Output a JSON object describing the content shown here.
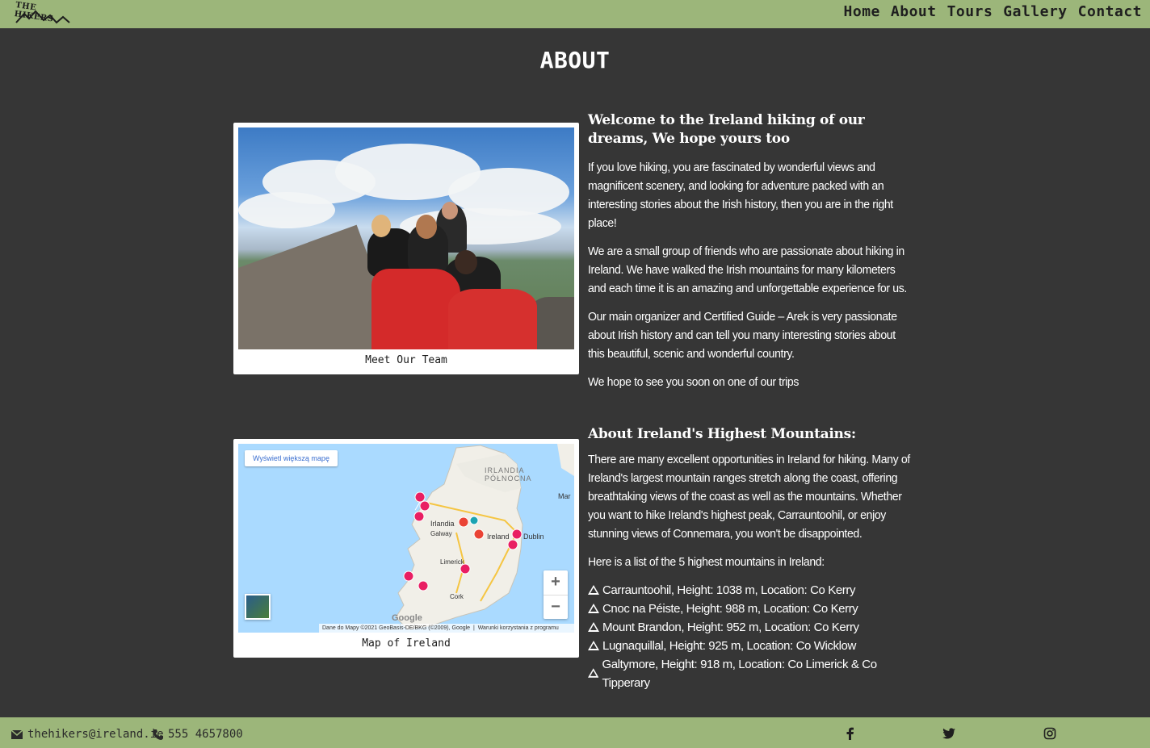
{
  "header": {
    "logo_text": "THE HIKERS",
    "nav": [
      "Home",
      "About",
      "Tours",
      "Gallery",
      "Contact"
    ]
  },
  "page_title": "ABOUT",
  "team_figure": {
    "caption": "Meet Our Team"
  },
  "map_figure": {
    "caption": "Map of Ireland",
    "view_larger_btn": "Wyświetl większą mapę",
    "labels": {
      "northern_ireland": "IRLANDIA\nPÓŁNOCNA",
      "irlandia": "Irlandia",
      "galway": "Galway",
      "ireland": "Ireland",
      "dublin": "Dublin",
      "limerick": "Limerick",
      "cork": "Cork",
      "mar": "Mar"
    },
    "attribution": "Dane do Mapy ©2021 GeoBasis-DE/BKG (©2009), Google",
    "terms": "Warunki korzystania z programu",
    "google": "Google",
    "zoom_in": "+",
    "zoom_out": "−"
  },
  "intro": {
    "heading": "Welcome to the Ireland hiking of our dreams, We hope yours too",
    "paragraphs": [
      "If you love hiking, you are fascinated by wonderful views and magnificent scenery, and looking for adventure packed with an interesting stories about the Irish history, then you are in the right place!",
      "We are a small group of friends who are passionate about hiking in Ireland. We have walked the Irish mountains for many kilometers and each time it is an amazing and unforgettable experience for us.",
      "Our main organizer and Certified Guide – Arek is very passionate about Irish history and can tell you many interesting stories about this beautiful, scenic and wonderful country.",
      "We hope to see you soon on one of our trips"
    ]
  },
  "mountains_section": {
    "heading": "About Ireland's Highest Mountains:",
    "paragraph": "There are many excellent opportunities in Ireland for hiking. Many of Ireland's largest mountain ranges stretch along the coast, offering breathtaking views of the coast as well as the mountains. Whether you want to hike Ireland's highest peak, Carrauntoohil, or enjoy stunning views of Connemara, you won't be disappointed.",
    "list_intro": "Here is a list of the 5 highest mountains in Ireland:",
    "mountains": [
      "Carrauntoohil, Height: 1038 m, Location: Co Kerry",
      "Cnoc na Péiste, Height: 988 m, Location: Co Kerry",
      "Mount Brandon, Height: 952 m, Location: Co Kerry",
      "Lugnaquillal, Height: 925 m, Location: Co Wicklow",
      "Galtymore, Height: 918 m, Location: Co Limerick & Co Tipperary"
    ]
  },
  "footer": {
    "email": "thehikers@ireland.ie",
    "phone": "555 4657800",
    "social": [
      "facebook-icon",
      "twitter-icon",
      "instagram-icon"
    ]
  },
  "colors": {
    "bar": "#9cb67a",
    "background": "#363636",
    "pin_red": "#ea4335",
    "pin_pink": "#e91e63"
  }
}
